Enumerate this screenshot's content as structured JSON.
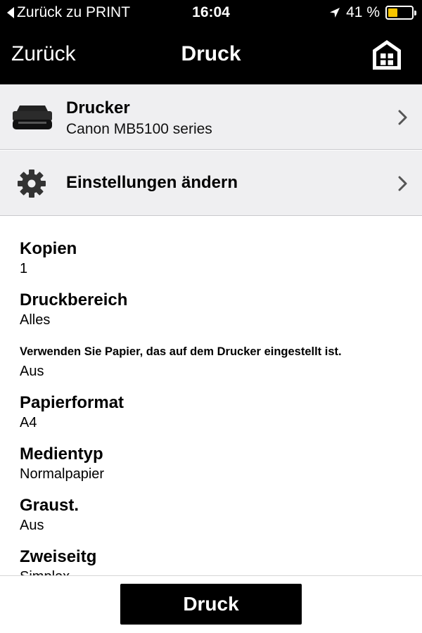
{
  "status_bar": {
    "back_label": "Zurück zu PRINT",
    "time": "16:04",
    "battery_percent": "41 %",
    "battery_level": 0.41,
    "battery_color": "#f5c400"
  },
  "nav": {
    "back_label": "Zurück",
    "title": "Druck",
    "home_icon": "home-icon"
  },
  "printer": {
    "title": "Drucker",
    "model": "Canon MB5100 series",
    "icon": "printer-icon"
  },
  "settings_link": {
    "label": "Einstellungen ändern",
    "icon": "gear-icon"
  },
  "settings": [
    {
      "label": "Kopien",
      "value": "1"
    },
    {
      "label": "Druckbereich",
      "value": "Alles"
    },
    {
      "label": "Verwenden Sie Papier, das auf dem Drucker eingestellt ist.",
      "value": "Aus"
    },
    {
      "label": "Papierformat",
      "value": "A4"
    },
    {
      "label": "Medientyp",
      "value": "Normalpapier"
    },
    {
      "label": "Graust.",
      "value": "Aus"
    },
    {
      "label": "Zweiseitg",
      "value": "Simplex"
    }
  ],
  "print_button": {
    "label": "Druck"
  },
  "colors": {
    "bar_background": "#000000",
    "cell_background": "#efeff1",
    "accent_battery": "#f5c400"
  }
}
